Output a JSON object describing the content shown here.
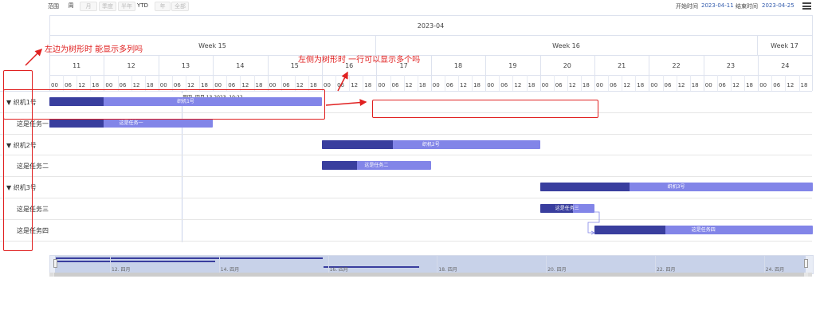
{
  "toolbar": {
    "range_label": "范围",
    "buttons": [
      {
        "label": "周",
        "active": true
      },
      {
        "label": "月",
        "active": false
      },
      {
        "label": "季度",
        "active": false
      },
      {
        "label": "半年",
        "active": false
      },
      {
        "label": "YTD",
        "active": true
      },
      {
        "label": "年",
        "active": false
      },
      {
        "label": "全部",
        "active": false
      }
    ],
    "start_label": "开始时间",
    "start_value": "2023-04-11",
    "end_label": "结束时间",
    "end_value": "2023-04-25"
  },
  "header": {
    "month": "2023-04",
    "weeks": [
      "Week 15",
      "Week 16",
      "Week 17"
    ],
    "days": [
      "11",
      "12",
      "13",
      "14",
      "15",
      "16",
      "17",
      "18",
      "19",
      "20",
      "21",
      "22",
      "23",
      "24"
    ],
    "hours": [
      "00",
      "06",
      "12",
      "18"
    ]
  },
  "rows": [
    {
      "label": "▼ 织机1号",
      "bar": "织机1号",
      "start": 0,
      "end": 5.0,
      "done": 1.0
    },
    {
      "label": "这是任务一",
      "bar": "这是任务一",
      "start": 0,
      "end": 3.0,
      "done": 1.0
    },
    {
      "label": "▼ 织机2号",
      "bar": "织机2号",
      "start": 5.0,
      "end": 9.0,
      "done": 1.3
    },
    {
      "label": "这是任务二",
      "bar": "这是任务二",
      "start": 5.0,
      "end": 7.0,
      "done": 0.65
    },
    {
      "label": "▼ 织机3号",
      "bar": "织机3号",
      "start": 9.0,
      "end": 14.0,
      "done": 1.65
    },
    {
      "label": "这是任务三",
      "bar": "这是任务三",
      "start": 9.0,
      "end": 10.0,
      "done": 0.6
    },
    {
      "label": "这是任务四",
      "bar": "这是任务四",
      "start": 10.0,
      "end": 14.0,
      "done": 1.3
    }
  ],
  "tooltip": "周四, 四月 13 2023, 10:22",
  "navigator": {
    "labels": [
      "12. 四月",
      "14. 四月",
      "16. 四月",
      "18. 四月",
      "20. 四月",
      "22. 四月",
      "24. 四月"
    ]
  },
  "annotations": {
    "left": "左边为树形时 能显示多列吗",
    "right": "左侧为树形时  一行可以显示多个吗"
  },
  "colors": {
    "bar": "#8285e8",
    "bar_done": "#393e9e",
    "annotation": "#e02020"
  }
}
